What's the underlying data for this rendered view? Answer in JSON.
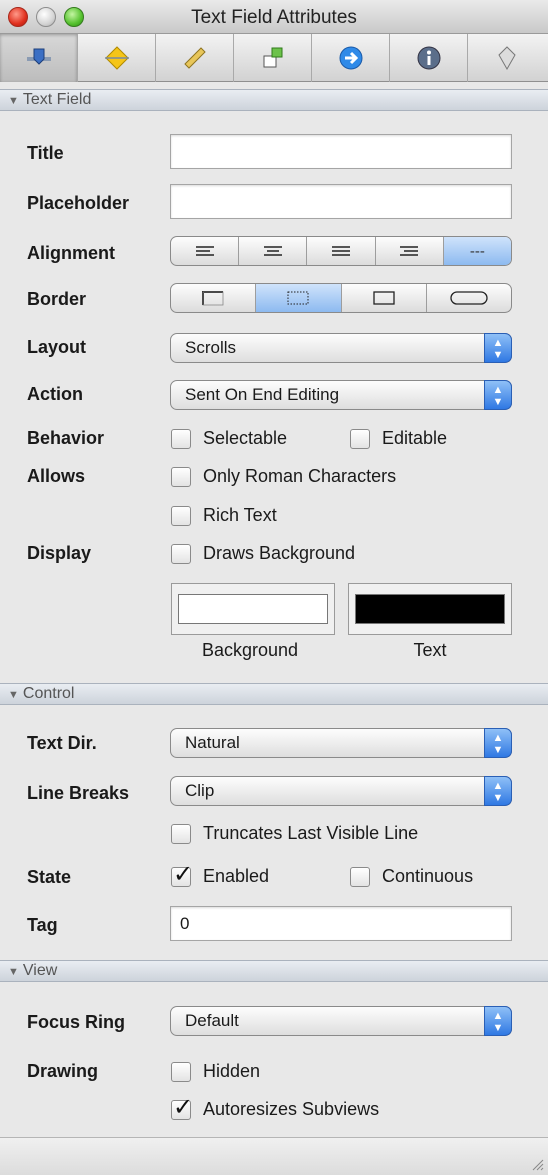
{
  "window": {
    "title": "Text Field Attributes"
  },
  "toolbar": {
    "tabs": [
      {
        "icon": "slider-icon",
        "active": true
      },
      {
        "icon": "diamond-icon",
        "active": false
      },
      {
        "icon": "ruler-icon",
        "active": false
      },
      {
        "icon": "connections-icon",
        "active": false
      },
      {
        "icon": "arrow-circle-icon",
        "active": false
      },
      {
        "icon": "info-icon",
        "active": false
      },
      {
        "icon": "tag-icon",
        "active": false
      }
    ]
  },
  "sections": {
    "text_field": {
      "header": "Text Field",
      "title_label": "Title",
      "title_value": "",
      "placeholder_label": "Placeholder",
      "placeholder_value": "",
      "alignment_label": "Alignment",
      "alignment_options": [
        "left",
        "center",
        "justified",
        "right",
        "natural"
      ],
      "alignment_natural_text": "---",
      "alignment_selected": "natural",
      "border_label": "Border",
      "border_options": [
        "line",
        "bezel",
        "rect",
        "rounded"
      ],
      "border_selected": "bezel",
      "layout_label": "Layout",
      "layout_value": "Scrolls",
      "action_label": "Action",
      "action_value": "Sent On End Editing",
      "behavior_label": "Behavior",
      "selectable_label": "Selectable",
      "selectable_checked": false,
      "editable_label": "Editable",
      "editable_checked": false,
      "allows_label": "Allows",
      "only_roman_label": "Only Roman Characters",
      "only_roman_checked": false,
      "rich_text_label": "Rich Text",
      "rich_text_checked": false,
      "display_label": "Display",
      "draws_bg_label": "Draws Background",
      "draws_bg_checked": false,
      "background_well_label": "Background",
      "background_color": "#ffffff",
      "text_well_label": "Text",
      "text_color": "#000000"
    },
    "control": {
      "header": "Control",
      "text_dir_label": "Text Dir.",
      "text_dir_value": "Natural",
      "line_breaks_label": "Line Breaks",
      "line_breaks_value": "Clip",
      "truncates_label": "Truncates Last Visible Line",
      "truncates_checked": false,
      "state_label": "State",
      "enabled_label": "Enabled",
      "enabled_checked": true,
      "continuous_label": "Continuous",
      "continuous_checked": false,
      "tag_label": "Tag",
      "tag_value": "0"
    },
    "view": {
      "header": "View",
      "focus_ring_label": "Focus Ring",
      "focus_ring_value": "Default",
      "drawing_label": "Drawing",
      "hidden_label": "Hidden",
      "hidden_checked": false,
      "autoresizes_label": "Autoresizes Subviews",
      "autoresizes_checked": true
    }
  },
  "colors": {
    "accent": "#2f78e3",
    "selected_segment": "#8dbaf0"
  }
}
